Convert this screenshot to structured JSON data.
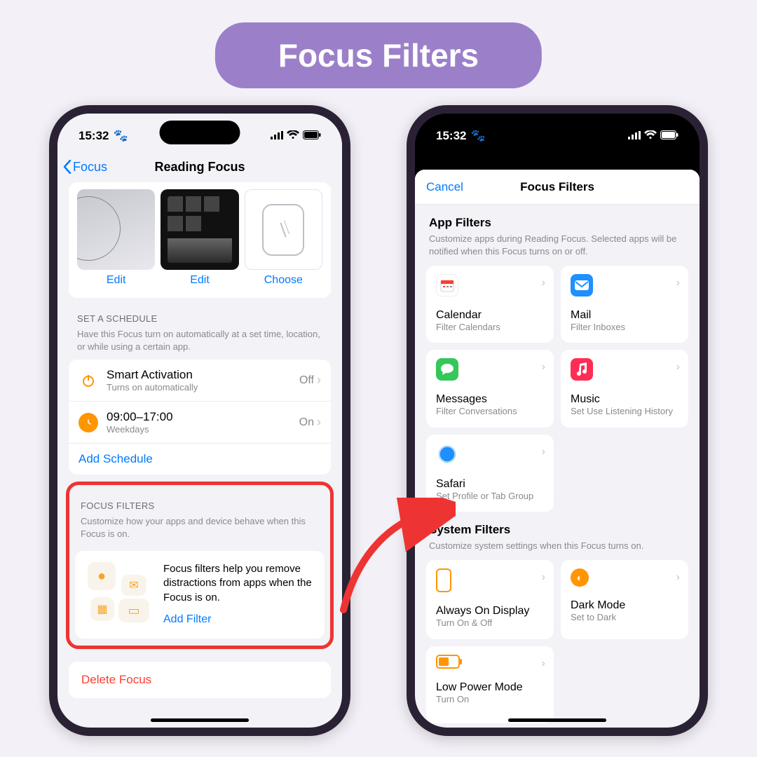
{
  "banner": "Focus Filters",
  "status": {
    "time": "15:32",
    "paw": "🐾"
  },
  "left": {
    "back": "Focus",
    "title": "Reading Focus",
    "thumbs": {
      "edit": "Edit",
      "choose": "Choose"
    },
    "schedule": {
      "header": "SET A SCHEDULE",
      "desc": "Have this Focus turn on automatically at a set time, location, or while using a certain app.",
      "smart_title": "Smart Activation",
      "smart_sub": "Turns on automatically",
      "smart_val": "Off",
      "time_title": "09:00–17:00",
      "time_sub": "Weekdays",
      "time_val": "On",
      "add": "Add Schedule"
    },
    "filters": {
      "header": "FOCUS FILTERS",
      "desc": "Customize how your apps and device behave when this Focus is on.",
      "blurb": "Focus filters help you remove distractions from apps when the Focus is on.",
      "add": "Add Filter"
    },
    "delete": "Delete Focus"
  },
  "right": {
    "cancel": "Cancel",
    "title": "Focus Filters",
    "app_header": "App Filters",
    "app_desc": "Customize apps during Reading Focus. Selected apps will be notified when this Focus turns on or off.",
    "tiles": {
      "calendar_t": "Calendar",
      "calendar_s": "Filter Calendars",
      "mail_t": "Mail",
      "mail_s": "Filter Inboxes",
      "messages_t": "Messages",
      "messages_s": "Filter Conversations",
      "music_t": "Music",
      "music_s": "Set Use Listening History",
      "safari_t": "Safari",
      "safari_s": "Set Profile or Tab Group"
    },
    "sys_header": "System Filters",
    "sys_desc": "Customize system settings when this Focus turns on.",
    "sys": {
      "aod_t": "Always On Display",
      "aod_s": "Turn On & Off",
      "dark_t": "Dark Mode",
      "dark_s": "Set to Dark",
      "lpm_t": "Low Power Mode",
      "lpm_s": "Turn On"
    }
  }
}
